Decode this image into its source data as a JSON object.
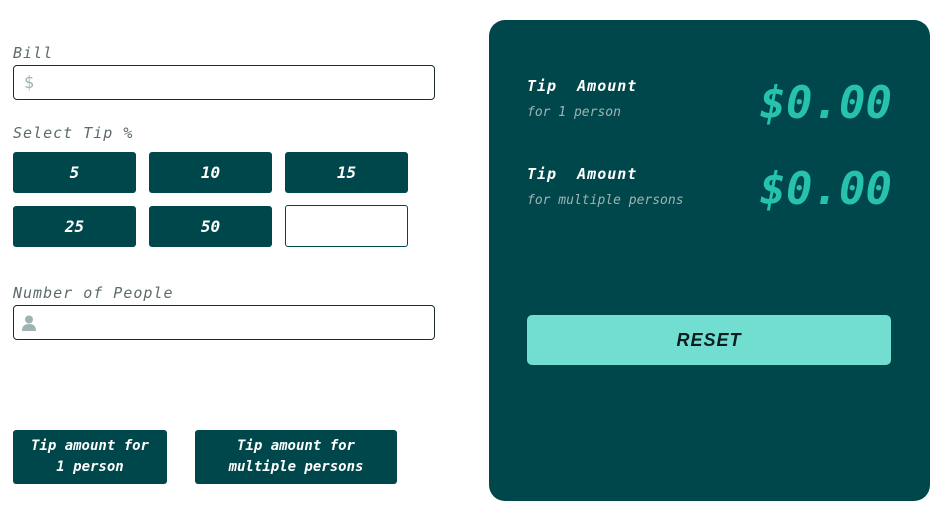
{
  "form": {
    "bill_label": "Bill",
    "bill_icon": "dollar-icon",
    "bill_icon_glyph": "$",
    "bill_value": "",
    "select_tip_label": "Select Tip %",
    "tip_options": [
      "5",
      "10",
      "15",
      "25",
      "50"
    ],
    "custom_tip_value": "",
    "people_label": "Number of People",
    "people_icon": "person-icon",
    "people_value": ""
  },
  "mode_buttons": {
    "one_person": "Tip amount for 1 person",
    "multiple_persons": "Tip amount for multiple persons"
  },
  "results": {
    "row1_title": "Tip  Amount",
    "row1_sub": "for 1 person",
    "row1_amount": "$0.00",
    "row2_title": "Tip  Amount",
    "row2_sub": "for multiple persons",
    "row2_amount": "$0.00",
    "reset_label": "RESET"
  },
  "colors": {
    "primary": "#00474b",
    "accent": "#26c2ad",
    "reset_bg": "#72ded1",
    "muted": "#9fb3b2",
    "background": "#ffffff"
  }
}
